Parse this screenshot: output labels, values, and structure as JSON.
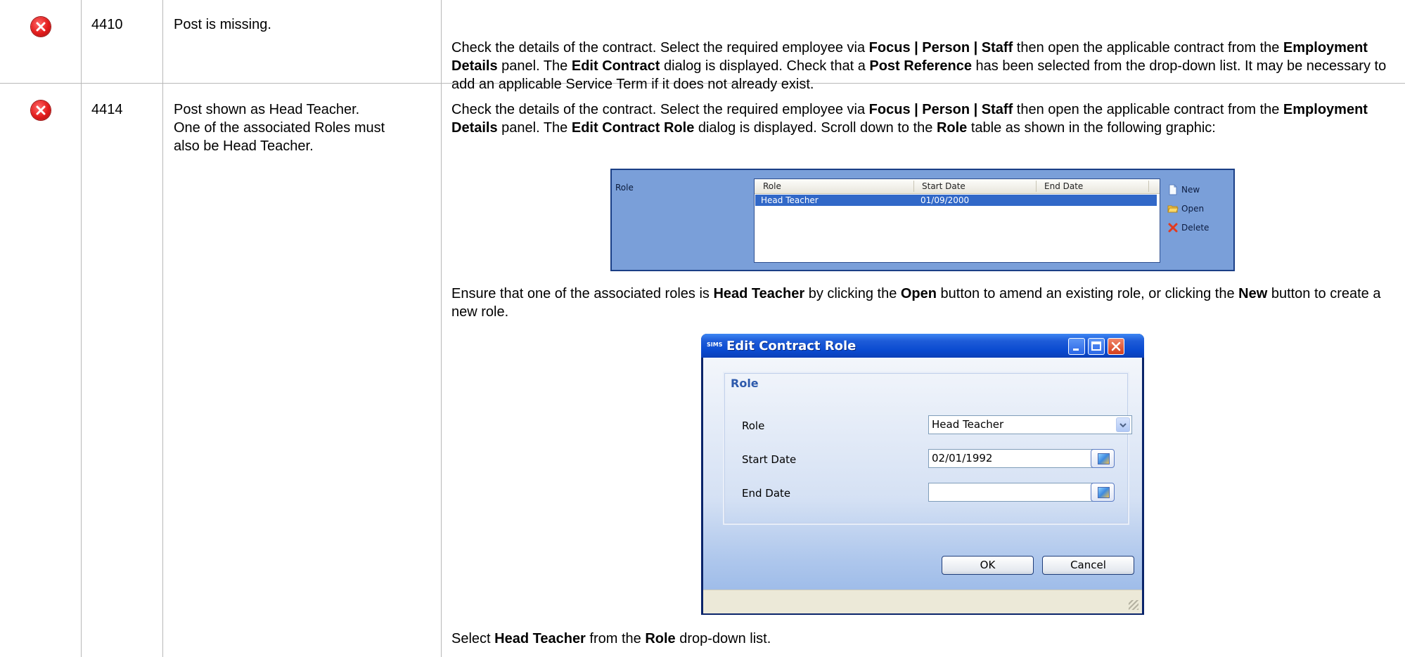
{
  "rows": [
    {
      "code": "4410",
      "message": "Post is missing.",
      "resolution": {
        "p1_a": "Check the details of the contract. Select the required employee via ",
        "p1_focus": "Focus | Person | Staff",
        "p1_b": " then open the applicable contract from the ",
        "p1_panel": "Employment Details",
        "p1_c": " panel. The ",
        "p1_dialog": "Edit Contract",
        "p1_d": " dialog is displayed. Check that a ",
        "p1_field": "Post Reference",
        "p1_e": " has been selected from the drop-down list. It may be necessary to add an applicable Service Term if it does not already exist."
      }
    },
    {
      "code": "4414",
      "message_line1": "Post shown as Head Teacher.",
      "message_line2": "One of the associated Roles must",
      "message_line3": "also be Head Teacher.",
      "resolution": {
        "p1_a": "Check the details of the contract. Select the required employee via ",
        "p1_focus": "Focus | Person | Staff",
        "p1_b": " then open the applicable contract from the ",
        "p1_panel": "Employment Details",
        "p1_c": " panel. The ",
        "p1_dialog": "Edit Contract Role",
        "p1_d": " dialog is displayed. Scroll down to the ",
        "p1_table": "Role",
        "p1_e": " table as shown in the following graphic:",
        "p2_a": "Ensure that one of the associated roles is ",
        "p2_role": "Head Teacher",
        "p2_b": " by clicking the ",
        "p2_open": "Open",
        "p2_c": " button to amend an existing role, or clicking the ",
        "p2_new": "New",
        "p2_d": " button to create a new role.",
        "p3_a": "Select ",
        "p3_role": "Head Teacher",
        "p3_b": " from the ",
        "p3_dd": "Role",
        "p3_c": " drop-down list."
      }
    }
  ],
  "role_panel": {
    "label": "Role",
    "columns": [
      "Role",
      "Start Date",
      "End Date"
    ],
    "row": {
      "role": "Head Teacher",
      "start": "01/09/2000",
      "end": ""
    },
    "actions": {
      "new": "New",
      "open": "Open",
      "delete": "Delete"
    }
  },
  "dialog": {
    "logo": "SIMS",
    "title": "Edit Contract Role",
    "group_title": "Role",
    "role_label": "Role",
    "role_value": "Head Teacher",
    "start_label": "Start Date",
    "start_value": "02/01/1992",
    "end_label": "End Date",
    "end_value": "",
    "ok": "OK",
    "cancel": "Cancel"
  },
  "colors": {
    "error_icon": "#e21c1c",
    "grid_line": "#b8b8b8",
    "role_panel_bg": "#7a9fd9",
    "selected_row": "#3168c8",
    "dialog_title": "#0a4ad0"
  }
}
